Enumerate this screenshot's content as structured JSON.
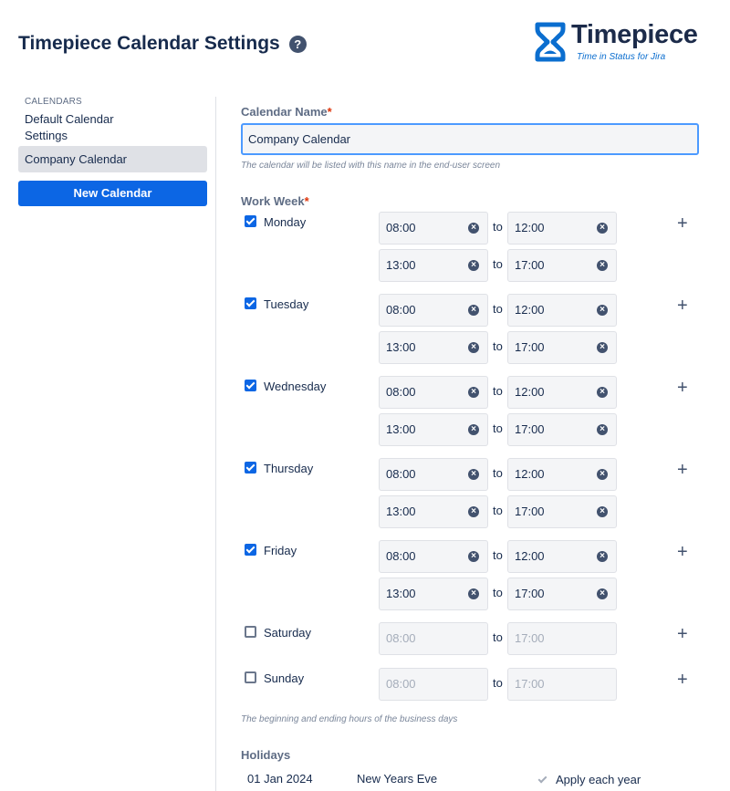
{
  "header": {
    "title": "Timepiece Calendar Settings",
    "help_icon": "help-icon"
  },
  "logo": {
    "name": "Timepiece",
    "tagline": "Time in Status for Jira"
  },
  "sidebar": {
    "heading": "CALENDARS",
    "items": [
      {
        "label": "Default Calendar Settings",
        "active": false
      },
      {
        "label": "Company Calendar",
        "active": true
      }
    ],
    "new_button": "New Calendar"
  },
  "form": {
    "name_label": "Calendar Name",
    "name_value": "Company Calendar",
    "name_help": "The calendar will be listed with this name in the end-user screen",
    "work_week_label": "Work Week",
    "required_mark": "*",
    "to_label": "to",
    "work_week_help": "The beginning and ending hours of the business days",
    "days": [
      {
        "name": "Monday",
        "checked": true,
        "slots": [
          [
            "08:00",
            "12:00"
          ],
          [
            "13:00",
            "17:00"
          ]
        ]
      },
      {
        "name": "Tuesday",
        "checked": true,
        "slots": [
          [
            "08:00",
            "12:00"
          ],
          [
            "13:00",
            "17:00"
          ]
        ]
      },
      {
        "name": "Wednesday",
        "checked": true,
        "slots": [
          [
            "08:00",
            "12:00"
          ],
          [
            "13:00",
            "17:00"
          ]
        ]
      },
      {
        "name": "Thursday",
        "checked": true,
        "slots": [
          [
            "08:00",
            "12:00"
          ],
          [
            "13:00",
            "17:00"
          ]
        ]
      },
      {
        "name": "Friday",
        "checked": true,
        "slots": [
          [
            "08:00",
            "12:00"
          ],
          [
            "13:00",
            "17:00"
          ]
        ]
      },
      {
        "name": "Saturday",
        "checked": false,
        "slots": [
          [
            "08:00",
            "17:00"
          ]
        ]
      },
      {
        "name": "Sunday",
        "checked": false,
        "slots": [
          [
            "08:00",
            "17:00"
          ]
        ]
      }
    ],
    "holidays_label": "Holidays",
    "holidays": [
      {
        "date": "01 Jan 2024",
        "name": "New Years Eve",
        "apply_each_year": true,
        "apply_label": "Apply each year"
      }
    ]
  }
}
